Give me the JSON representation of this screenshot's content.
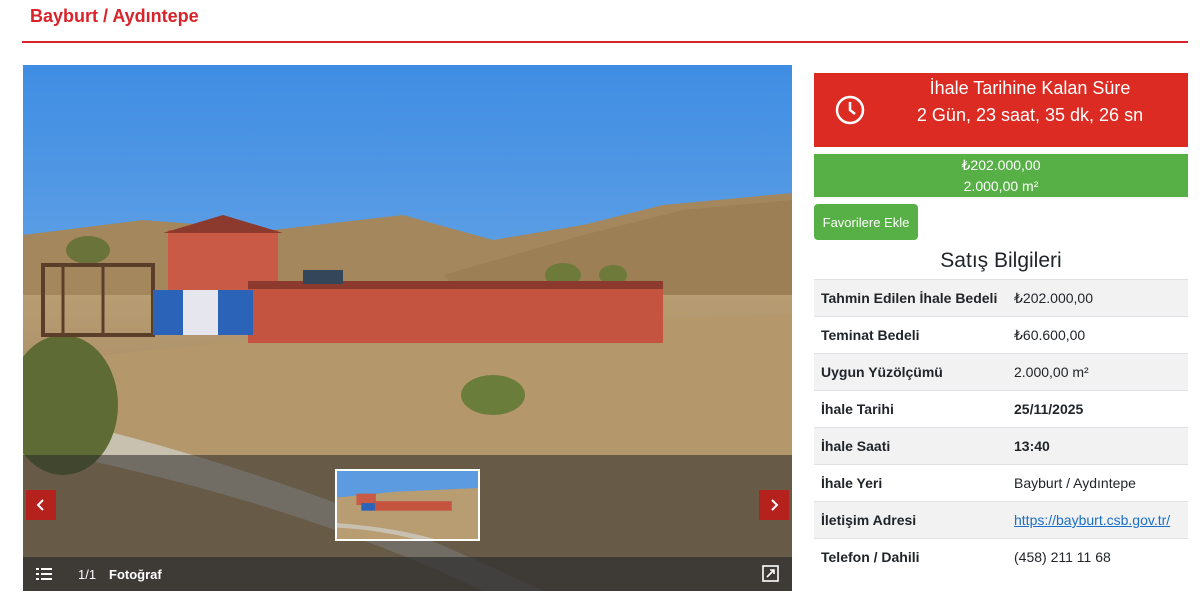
{
  "header": {
    "title": "Bayburt / Aydıntepe"
  },
  "gallery": {
    "counter": "1/1",
    "caption": "Fotoğraf",
    "sign_text": "INIZ",
    "icons": {
      "prev": "chevron-left-icon",
      "next": "chevron-right-icon",
      "menu": "list-icon",
      "expand": "expand-icon"
    }
  },
  "countdown": {
    "label": "İhale Tarihine Kalan Süre",
    "value": "2 Gün, 23 saat, 35 dk, 26 sn",
    "icon": "clock-icon",
    "color": "#dc2b22"
  },
  "price_box": {
    "price": "₺202.000,00",
    "area": "2.000,00 m²",
    "color": "#57b046"
  },
  "favorite_button": {
    "label": "Favorilere Ekle"
  },
  "sale_info": {
    "title": "Satış Bilgileri",
    "rows": [
      {
        "label": "Tahmin Edilen İhale Bedeli",
        "value": "₺202.000,00"
      },
      {
        "label": "Teminat Bedeli",
        "value": "₺60.600,00"
      },
      {
        "label": "Uygun Yüzölçümü",
        "value": "2.000,00 m²"
      },
      {
        "label": "İhale Tarihi",
        "value": "25/11/2025"
      },
      {
        "label": "İhale Saati",
        "value": "13:40"
      },
      {
        "label": "İhale Yeri",
        "value": "Bayburt / Aydıntepe"
      },
      {
        "label": "İletişim Adresi",
        "value": "https://bayburt.csb.gov.tr/"
      },
      {
        "label": "Telefon / Dahili",
        "value": "(458) 211 11 68"
      }
    ]
  },
  "colors": {
    "brand_red": "#d8232a",
    "link": "#1a6fc9"
  }
}
